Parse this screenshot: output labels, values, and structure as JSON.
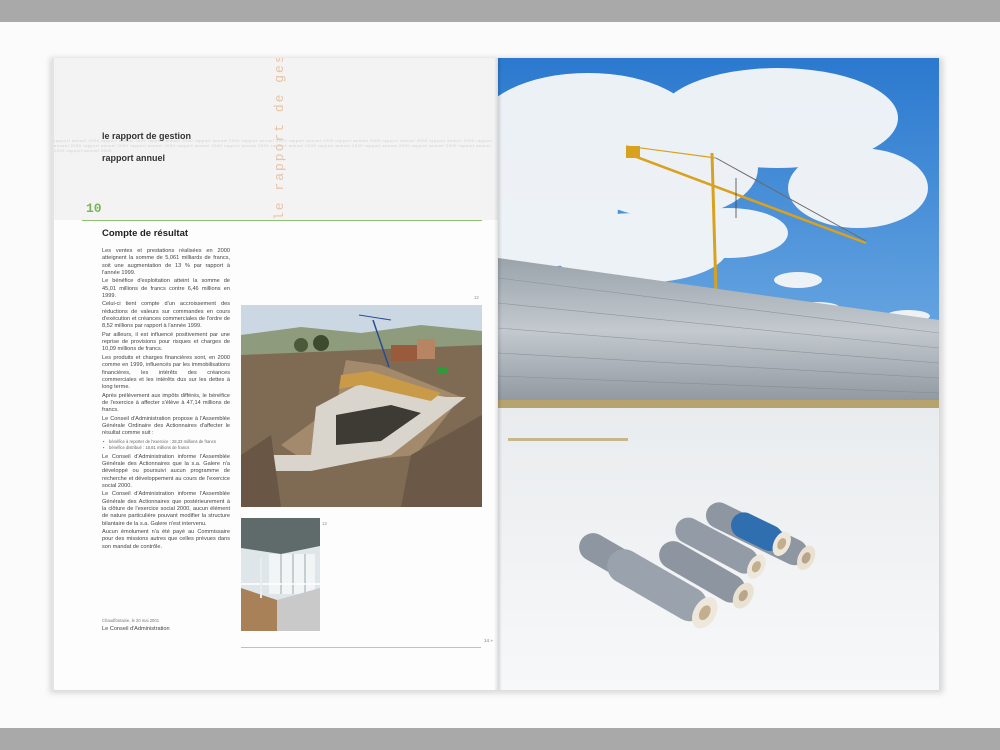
{
  "left_page": {
    "header_line1": "le rapport de gestion",
    "header_line2": "rapport annuel",
    "vertical_title": "le rapport de gestion",
    "page_number": "10",
    "section_title": "Compte de résultat",
    "paragraphs": [
      "Les ventes et prestations réalisées en 2000 atteignent la somme de 5,061 milliards de francs, soit une augmentation de 13 % par rapport à l'année 1999.",
      "Le bénéfice d'exploitation atteint la somme de 45,01 millions de francs contre 6,46 millions en 1999.",
      "Celui-ci tient compte d'un accroissement des réductions de valeurs sur commandes en cours d'exécution et créances commerciales de l'ordre de 8,52 millions par rapport à l'année 1999.",
      "Par ailleurs, il est influencé positivement par une reprise de provisions pour risques et charges de 10,09 millions de francs.",
      "Les produits et charges financières sont, en 2000 comme en 1999, influencés par les immobilisations financières, les intérêts des créances commerciales et les intérêts dus sur les dettes à long terme.",
      "Après prélèvement aux impôts différés, le bénéfice de l'exercice à affecter s'élève à 47,14 millions de francs.",
      "Le Conseil d'Administration propose à l'Assemblée Générale Ordinaire des Actionnaires d'affecter le résultat comme suit :"
    ],
    "bullets": [
      "bénéfice à reporter de l'exercice : 28,33 millions de francs",
      "bénéfice distribué : 18,81 millions de francs"
    ],
    "paragraphs2": [
      "Le Conseil d'Administration informe l'Assemblée Générale des Actionnaires que la s.a. Galere n'a développé ou poursuivi aucun programme de recherche et développement au cours de l'exercice social 2000.",
      "Le Conseil d'Administration informe l'Assemblée Générale des Actionnaires que postérieurement à la clôture de l'exercice social 2000, aucun élément de nature particulière pouvant modifier la structure bilantaire de la s.a. Galere n'est intervenu.",
      "Aucun émolument n'a été payé au Commissaire pour des missions autres que celles prévues dans son mandat de contrôle."
    ],
    "signature_place": "Chaudfontaine, le 20 mai 2001",
    "signature_name": "Le Conseil d'Administration",
    "photo1_caption": "12",
    "photo2_caption": "13",
    "footer_page": "14 »"
  },
  "colors": {
    "accent_green": "#7ab553",
    "accent_orange": "#e1b79a",
    "sky_blue": "#2f7fd0",
    "crane_yellow": "#d9a21e"
  }
}
